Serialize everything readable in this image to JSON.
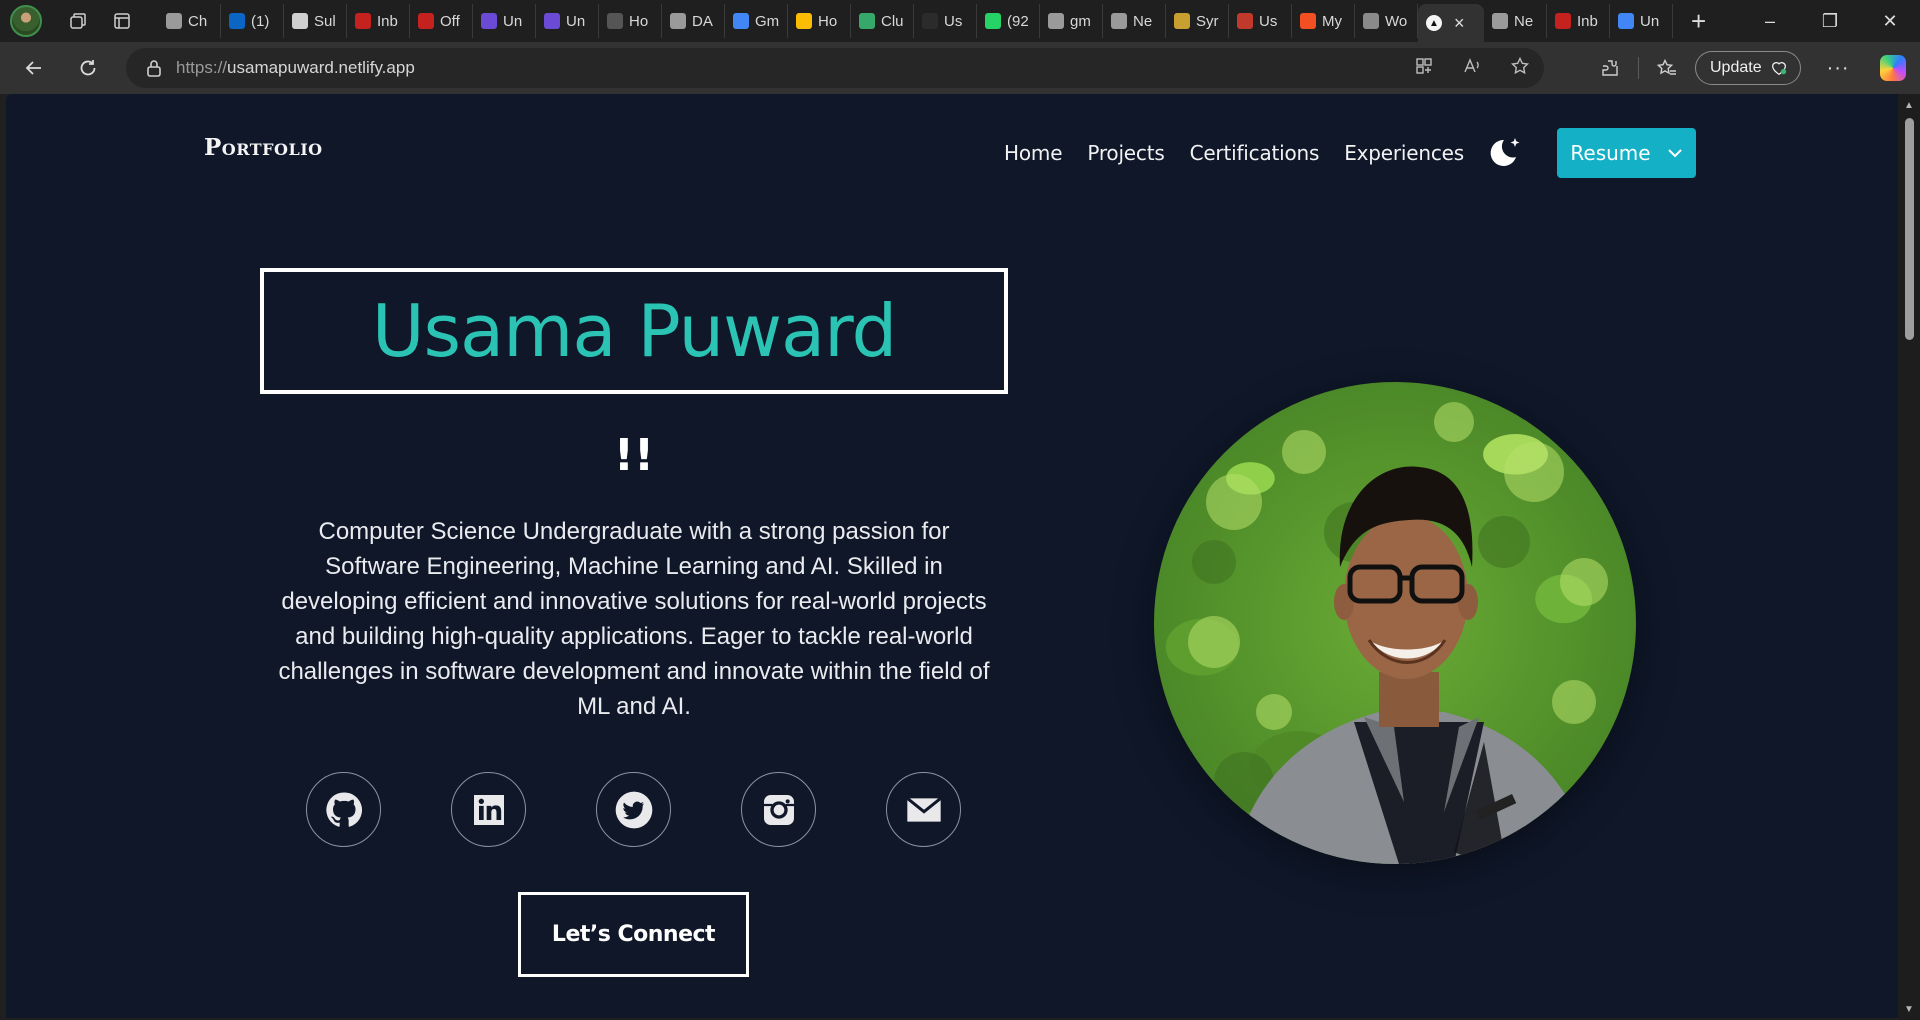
{
  "browser": {
    "tabs": [
      {
        "label": "Ch",
        "icon": "openai-icon",
        "color": "#9a9a9a"
      },
      {
        "label": "(1)",
        "icon": "linkedin-icon",
        "color": "#0a66c2"
      },
      {
        "label": "Sul",
        "icon": "shield-icon",
        "color": "#d0d0d0"
      },
      {
        "label": "Inb",
        "icon": "gmail-icon",
        "color": "#c5221f"
      },
      {
        "label": "Off",
        "icon": "gmail-icon",
        "color": "#c5221f"
      },
      {
        "label": "Un",
        "icon": "list-icon",
        "color": "#6b4bd6"
      },
      {
        "label": "Un",
        "icon": "list-icon",
        "color": "#6b4bd6"
      },
      {
        "label": "Ho",
        "icon": "lambda-icon",
        "color": "#555555"
      },
      {
        "label": "DA",
        "icon": "shield-icon",
        "color": "#9a9a9a"
      },
      {
        "label": "Gm",
        "icon": "google-icon",
        "color": "#4285f4"
      },
      {
        "label": "Ho",
        "icon": "drive-icon",
        "color": "#fbbc04"
      },
      {
        "label": "Clu",
        "icon": "link-icon",
        "color": "#36a86a"
      },
      {
        "label": "Us",
        "icon": "github-icon",
        "color": "#2b2b2b"
      },
      {
        "label": "(92",
        "icon": "whatsapp-icon",
        "color": "#25d366"
      },
      {
        "label": "gm",
        "icon": "search-icon",
        "color": "#9a9a9a"
      },
      {
        "label": "Ne",
        "icon": "newtab-icon",
        "color": "#9a9a9a"
      },
      {
        "label": "Syr",
        "icon": "cube-icon",
        "color": "#c8a030"
      },
      {
        "label": "Us",
        "icon": "pdf-icon",
        "color": "#c0392b"
      },
      {
        "label": "My",
        "icon": "microsoft-icon",
        "color": "#f25022"
      },
      {
        "label": "Wo",
        "icon": "word-icon",
        "color": "#8a8a8a"
      }
    ],
    "active_tab_close": "×",
    "tabs_after": [
      {
        "label": "Ne",
        "icon": "newtab-icon",
        "color": "#9a9a9a"
      },
      {
        "label": "Inb",
        "icon": "gmail-icon",
        "color": "#c5221f"
      },
      {
        "label": "Un",
        "icon": "docs-icon",
        "color": "#4285f4"
      }
    ],
    "new_tab": "+",
    "url_protocol": "https://",
    "url_host": "usamapuward.netlify.app",
    "update_label": "Update",
    "window_controls": [
      "–",
      "❐",
      "✕"
    ]
  },
  "site": {
    "logo": "Portfolio",
    "nav": [
      "Home",
      "Projects",
      "Certifications",
      "Experiences"
    ],
    "resume_label": "Resume",
    "name": "Usama Puward",
    "exclaim": "!!",
    "bio": "Computer Science Undergraduate with a strong passion for Software Engineering, Machine Learning and AI. Skilled in developing efficient and innovative solutions for real-world projects and building high-quality applications. Eager to tackle real-world challenges in software development and innovate within the field of ML and AI.",
    "socials": [
      "github-icon",
      "linkedin-icon",
      "twitter-icon",
      "instagram-icon",
      "mail-icon"
    ],
    "connect_label": "Let’s Connect",
    "accent": "#2bc4b4",
    "resume_color": "#14b1c6",
    "background": "#0f1729"
  }
}
